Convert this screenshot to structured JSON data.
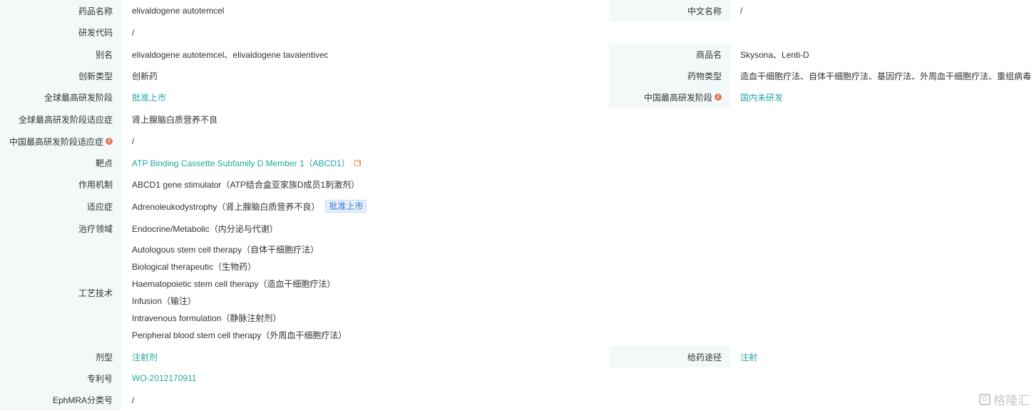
{
  "fields": {
    "drug_name": {
      "label": "药品名称",
      "value": "elivaldogene autotemcel"
    },
    "chinese_name": {
      "label": "中文名称",
      "value": "/"
    },
    "dev_code": {
      "label": "研发代码",
      "value": "/"
    },
    "alias": {
      "label": "别名",
      "value": "elivaldogene autotemcel、elivaldogene tavalentivec"
    },
    "trade_name": {
      "label": "商品名",
      "value": "Skysona、Lenti-D"
    },
    "innovation_type": {
      "label": "创新类型",
      "value": "创新药"
    },
    "drug_type": {
      "label": "药物类型",
      "value": "造血干细胞疗法、自体干细胞疗法、基因疗法、外周血干细胞疗法、重组病毒"
    },
    "global_stage": {
      "label": "全球最高研发阶段",
      "value": "批准上市"
    },
    "china_stage": {
      "label": "中国最高研发阶段",
      "value": "国内未研发"
    },
    "global_indication": {
      "label": "全球最高研发阶段适应症",
      "value": "肾上腺脑白质营养不良"
    },
    "china_indication": {
      "label": "中国最高研发阶段适应症",
      "value": "/"
    },
    "target": {
      "label": "靶点",
      "value": "ATP Binding Cassette Subfamily D Member 1（ABCD1）"
    },
    "mechanism": {
      "label": "作用机制",
      "value": "ABCD1 gene stimulator（ATP结合盒亚家族D成员1刺激剂）"
    },
    "indication": {
      "label": "适应症",
      "value": "Adrenoleukodystrophy（肾上腺脑白质营养不良）",
      "badge": "批准上市"
    },
    "therapeutic_area": {
      "label": "治疗领域",
      "value": "Endocrine/Metabolic（内分泌与代谢）"
    },
    "technology": {
      "label": "工艺技术",
      "items": [
        "Autologous stem cell therapy（自体干细胞疗法）",
        "Biological therapeutic（生物药）",
        "Haematopoietic stem cell therapy（造血干细胞疗法）",
        "Infusion（输注）",
        "Intravenous formulation（静脉注射剂）",
        "Peripheral blood stem cell therapy（外周血干细胞疗法）"
      ]
    },
    "dosage_form": {
      "label": "剂型",
      "value": "注射剂"
    },
    "route": {
      "label": "给药途径",
      "value": "注射"
    },
    "patent": {
      "label": "专利号",
      "value": "WO-2012170911"
    },
    "ephmra": {
      "label": "EphMRA分类号",
      "value": "/"
    }
  },
  "watermark": {
    "text": "格隆汇",
    "icon": "logo-icon"
  },
  "colors": {
    "link": "#1fa8a0",
    "label_bg": "#f3f8f8",
    "badge_text": "#3a7bd5",
    "info_icon": "#e07a5f"
  }
}
